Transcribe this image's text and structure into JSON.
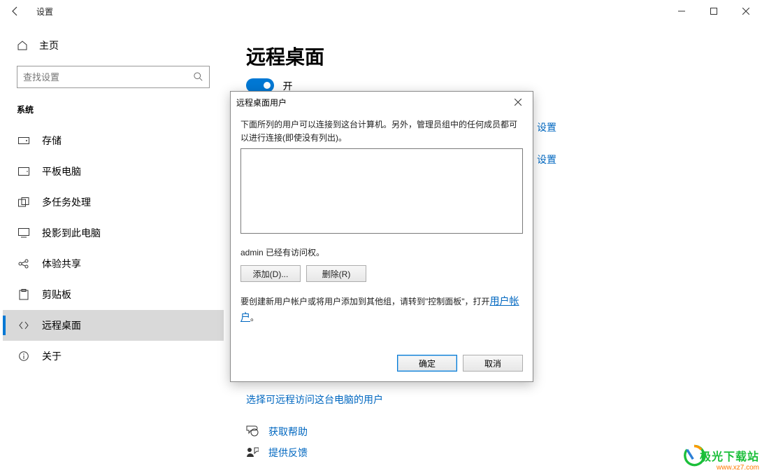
{
  "titlebar": {
    "back": "←",
    "title": "设置"
  },
  "sidebar": {
    "home": "主页",
    "search_placeholder": "查找设置",
    "section": "系统",
    "items": [
      {
        "label": "存储"
      },
      {
        "label": "平板电脑"
      },
      {
        "label": "多任务处理"
      },
      {
        "label": "投影到此电脑"
      },
      {
        "label": "体验共享"
      },
      {
        "label": "剪贴板"
      },
      {
        "label": "远程桌面"
      },
      {
        "label": "关于"
      }
    ]
  },
  "content": {
    "title": "远程桌面",
    "toggle_state": "开",
    "peek_setting1": "设置",
    "peek_setting2": "设置",
    "select_users_link": "选择可远程访问这台电脑的用户",
    "help": "获取帮助",
    "feedback": "提供反馈"
  },
  "dialog": {
    "title": "远程桌面用户",
    "desc": "下面所列的用户可以连接到这台计算机。另外，管理员组中的任何成员都可以进行连接(即使没有列出)。",
    "access_line": "admin 已经有访问权。",
    "add_btn": "添加(D)...",
    "remove_btn": "删除(R)",
    "create_prefix": "要创建新用户帐户或将用户添加到其他组，请转到\"控制面板\"，打开",
    "create_link": "用户帐户",
    "create_suffix": "。",
    "ok": "确定",
    "cancel": "取消"
  },
  "watermark": {
    "line1": "极光下载站",
    "line2": "www.xz7.com"
  }
}
